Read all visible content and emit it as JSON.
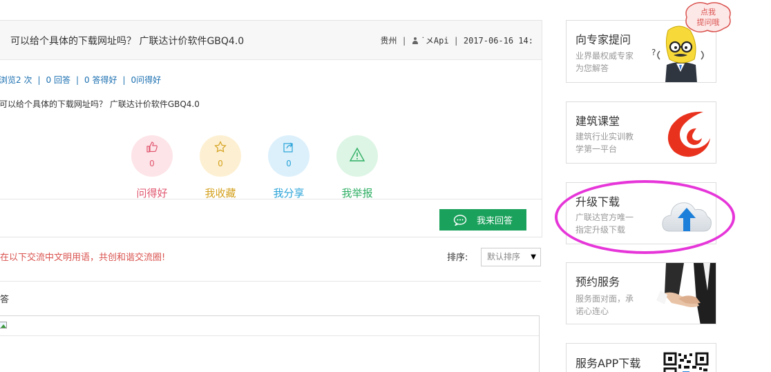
{
  "question": {
    "title": "可以给个具体的下载网址吗？ 广联达计价软件GBQ4.0",
    "location": "贵州",
    "user": "˙メApi",
    "datetime": "2017-06-16 14:",
    "stats": {
      "views": "浏览2 次",
      "answers": "0 回答",
      "liked_answers": "0 答得好",
      "question_likes": "0问得好"
    },
    "body": "可以给个具体的下载网址吗？ 广联达计价软件GBQ4.0",
    "actions": [
      {
        "label": "问得好",
        "count": "0",
        "icon": "thumbs-up-icon",
        "color": "#e0566f",
        "bg": "#fde4e8"
      },
      {
        "label": "我收藏",
        "count": "0",
        "icon": "star-icon",
        "color": "#d4a11e",
        "bg": "#fdf0d2"
      },
      {
        "label": "我分享",
        "count": "0",
        "icon": "share-icon",
        "color": "#2aa3d8",
        "bg": "#dcf0fb"
      },
      {
        "label": "我举报",
        "count": "",
        "icon": "warning-icon",
        "color": "#2eae63",
        "bg": "#dcf5e4"
      }
    ],
    "answer_button": "我来回答"
  },
  "answers": {
    "notice": "在以下交流中文明用语，共创和谐交流圈!",
    "sort_label": "排序:",
    "sort_value": "默认排序",
    "heading": "答"
  },
  "sidebar": {
    "bubble_text_1": "点我",
    "bubble_text_2": "提问哦",
    "cards": [
      {
        "title": "向专家提问",
        "sub1": "业界最权威专家",
        "sub2": "为您解答",
        "icon": "cartoon-expert-icon"
      },
      {
        "title": "建筑课堂",
        "sub1": "建筑行业实训教",
        "sub2": "学第一平台",
        "icon": "glodon-logo-icon"
      },
      {
        "title": "升级下载",
        "sub1": "广联达官方唯一",
        "sub2": "指定升级下载",
        "icon": "cloud-upload-icon"
      },
      {
        "title": "预约服务",
        "sub1": "服务面对面，承",
        "sub2": "诺心连心",
        "icon": "handshake-icon"
      },
      {
        "title": "服务APP下载",
        "icon": "qr-code-icon"
      }
    ]
  },
  "colors": {
    "accent_green": "#1aa15b",
    "link_blue": "#1a6fb0",
    "highlight_magenta": "#e636d9",
    "notice_red": "#d9534f"
  }
}
